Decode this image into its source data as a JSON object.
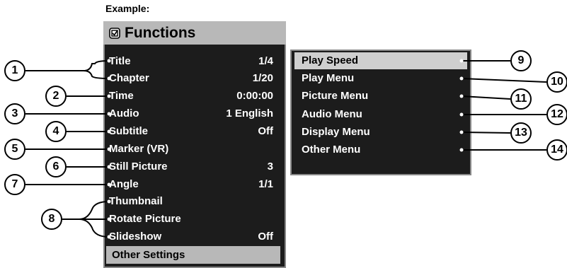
{
  "caption": "Example:",
  "functions_panel": {
    "title": "Functions",
    "icon": "checkbox-icon",
    "rows": [
      {
        "label": "Title",
        "value": "1/4"
      },
      {
        "label": "Chapter",
        "value": "1/20"
      },
      {
        "label": "Time",
        "value": "0:00:00"
      },
      {
        "label": "Audio",
        "value": "1 English"
      },
      {
        "label": "Subtitle",
        "value": "Off"
      },
      {
        "label": "Marker (VR)",
        "value": ""
      },
      {
        "label": "Still Picture",
        "value": "3"
      },
      {
        "label": "Angle",
        "value": "1/1"
      },
      {
        "label": "Thumbnail",
        "value": ""
      },
      {
        "label": "Rotate Picture",
        "value": ""
      },
      {
        "label": "Slideshow",
        "value": "Off"
      }
    ],
    "footer": "Other Settings"
  },
  "sub_menu": {
    "items": [
      {
        "label": "Play Speed",
        "selected": true
      },
      {
        "label": "Play Menu",
        "selected": false
      },
      {
        "label": "Picture Menu",
        "selected": false
      },
      {
        "label": "Audio Menu",
        "selected": false
      },
      {
        "label": "Display Menu",
        "selected": false
      },
      {
        "label": "Other Menu",
        "selected": false
      }
    ]
  },
  "callouts": {
    "left": [
      "1",
      "2",
      "3",
      "4",
      "5",
      "6",
      "7",
      "8"
    ],
    "right": [
      "9",
      "10",
      "11",
      "12",
      "13",
      "14"
    ]
  },
  "colors": {
    "panel_bg": "#1c1c1c",
    "header_bg": "#b8b8b8",
    "selected_bg": "#cfcfcf"
  }
}
